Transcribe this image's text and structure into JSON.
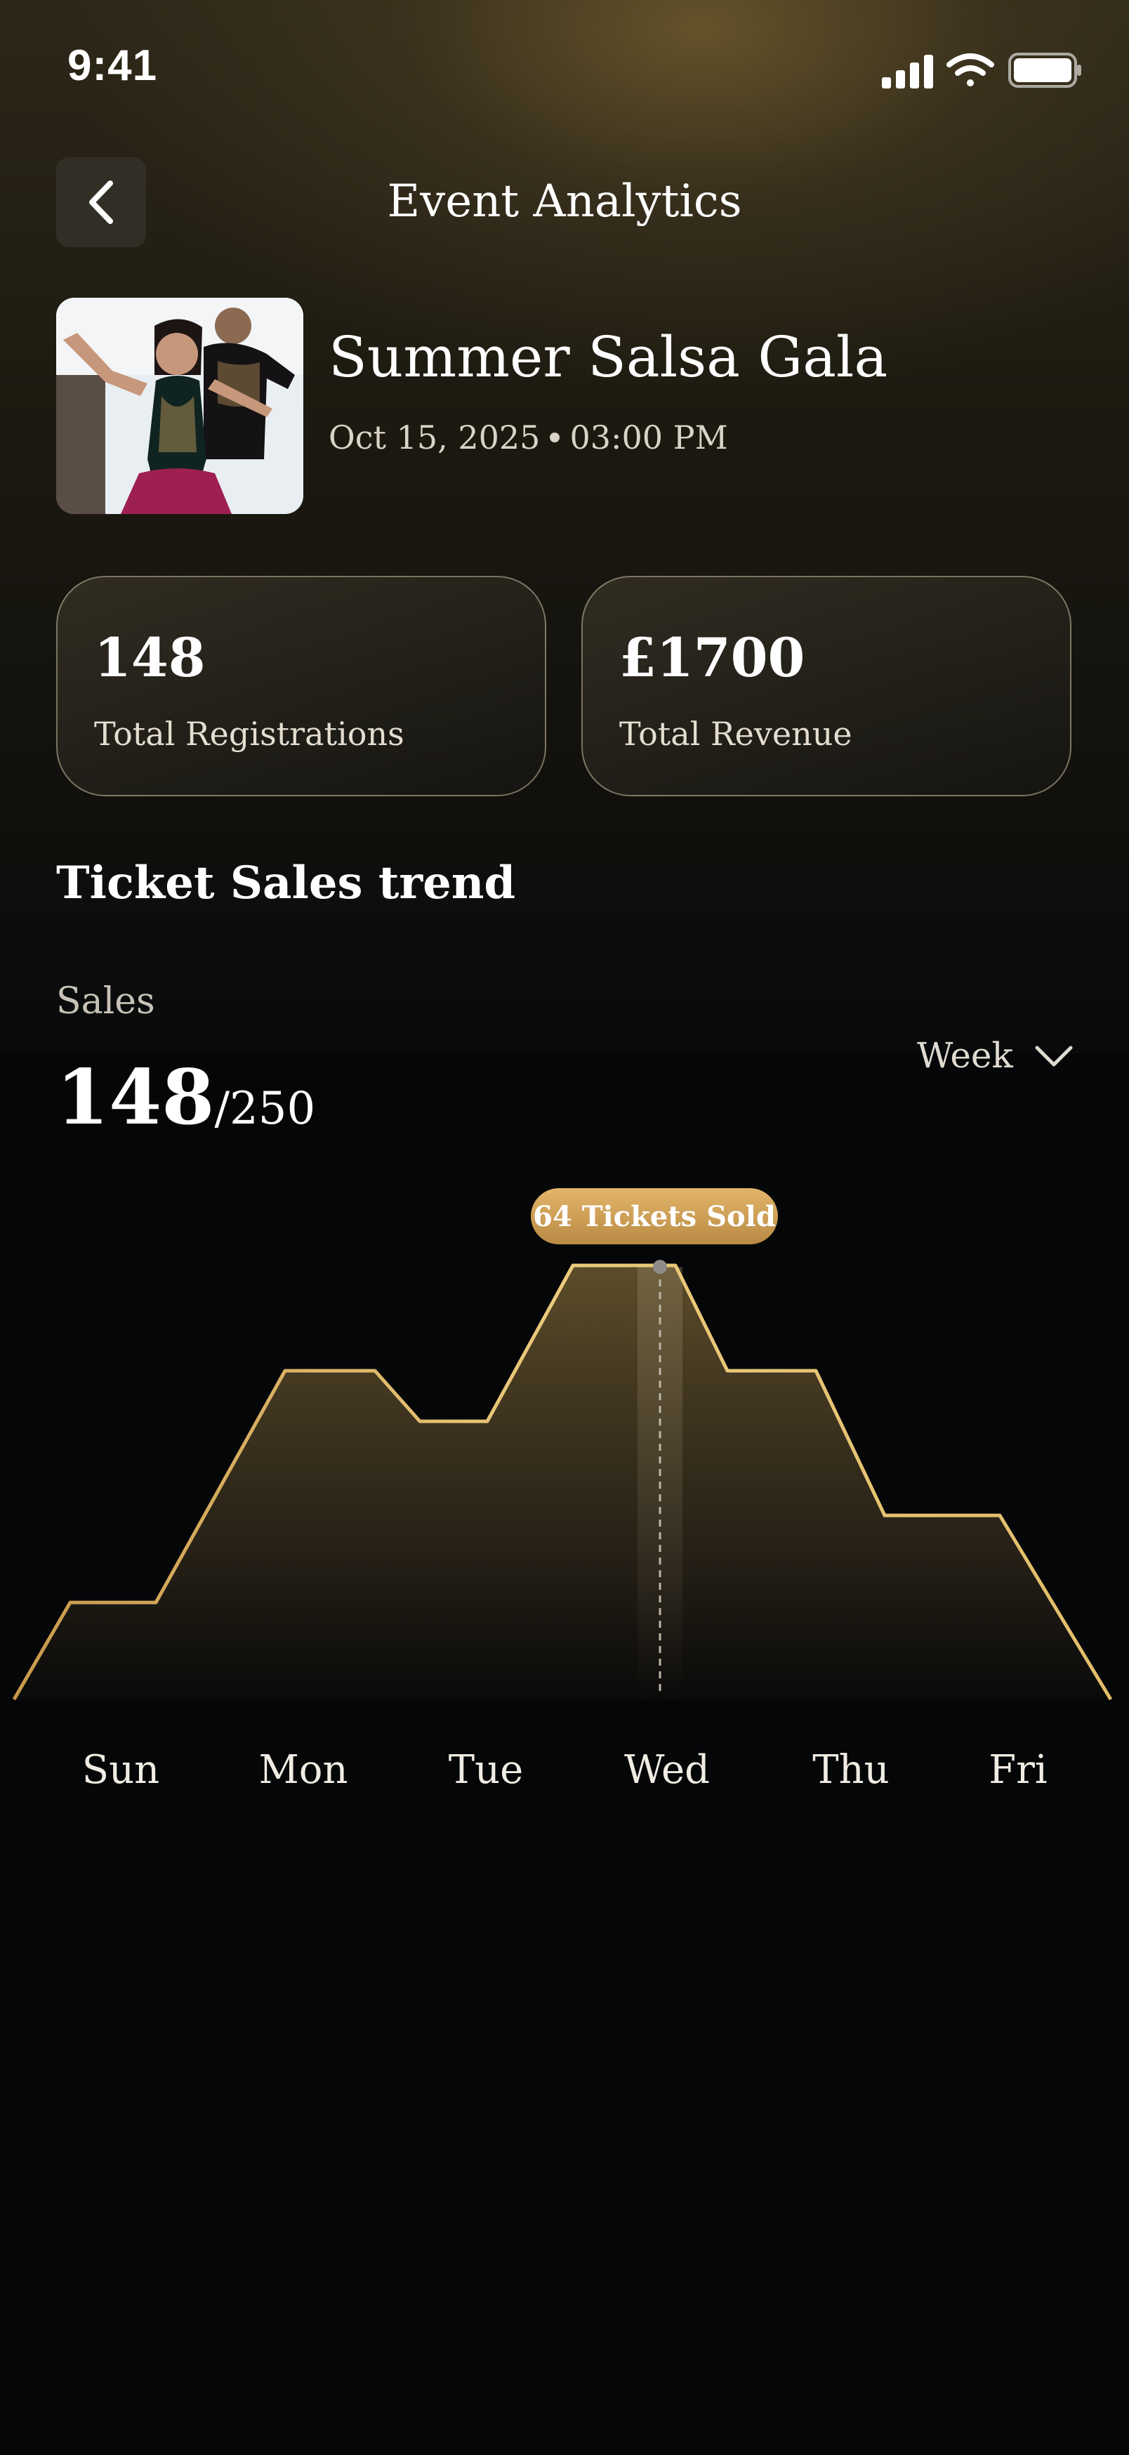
{
  "status_bar": {
    "time": "9:41"
  },
  "header": {
    "title": "Event Analytics"
  },
  "event": {
    "name": "Summer Salsa Gala",
    "date": "Oct 15, 2025",
    "time": "03:00 PM"
  },
  "stats": [
    {
      "value": "148",
      "label": "Total Registrations"
    },
    {
      "value": "£1700",
      "label": "Total Revenue"
    }
  ],
  "section": {
    "title": "Ticket Sales trend"
  },
  "sales": {
    "label": "Sales",
    "value": "148",
    "total": "/250"
  },
  "period": {
    "selected": "Week"
  },
  "tooltip": {
    "text": "64 Tickets Sold"
  },
  "colors": {
    "accent": "#e2bd6a",
    "background": "#050608"
  },
  "chart_data": {
    "type": "area",
    "categories": [
      "Sun",
      "Mon",
      "Tue",
      "Wed",
      "Thu",
      "Fri"
    ],
    "highlighted": "Wed",
    "highlighted_value": 64
  }
}
